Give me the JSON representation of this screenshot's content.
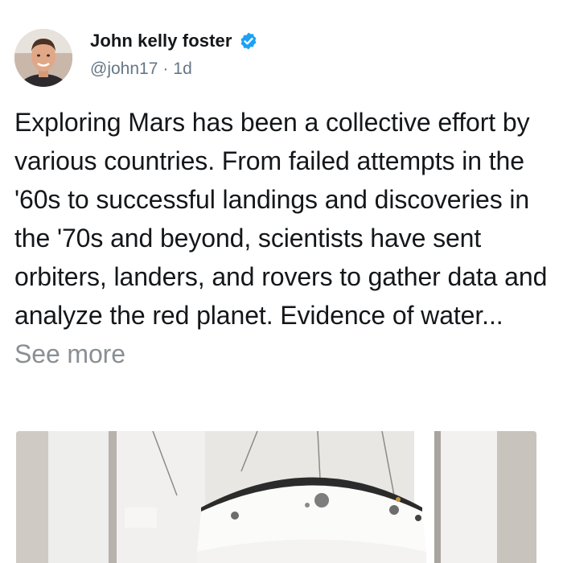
{
  "author": {
    "display_name": "John kelly foster",
    "handle": "@john17",
    "separator": "·",
    "time": "1d",
    "avatar_icon": "profile-photo",
    "verified_icon": "verified-badge-icon",
    "verified_color": "#1da1f2"
  },
  "tweet": {
    "text": "Exploring Mars has been a collective effort by various countries. From failed attempts in the '60s to successful landings and discoveries in the '70s and beyond, scientists have sent orbiters, landers, and rovers to gather data and analyze the red planet. Evidence of water...",
    "see_more": "See more"
  },
  "media": {
    "image_icon": "spacecraft-photo"
  },
  "colors": {
    "text": "#14171a",
    "muted": "#657786",
    "see_more": "#8a8f94"
  }
}
